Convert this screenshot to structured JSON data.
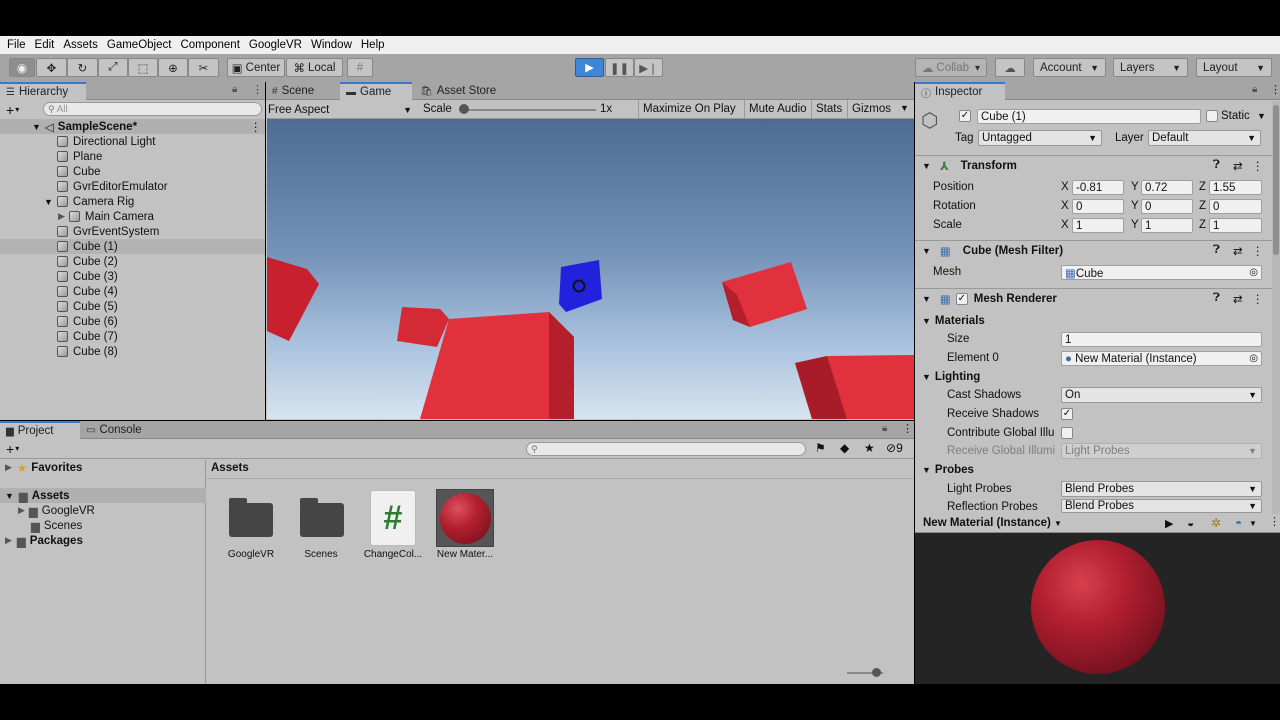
{
  "menu": [
    "File",
    "Edit",
    "Assets",
    "GameObject",
    "Component",
    "GoogleVR",
    "Window",
    "Help"
  ],
  "toolbar": {
    "pivot": "Center",
    "space": "Local",
    "collab": "Collab",
    "account": "Account",
    "layers": "Layers",
    "layout": "Layout"
  },
  "hierarchy": {
    "tab": "Hierarchy",
    "search_placeholder": "All",
    "scene": "SampleScene*",
    "items": [
      {
        "label": "Directional Light"
      },
      {
        "label": "Plane"
      },
      {
        "label": "Cube"
      },
      {
        "label": "GvrEditorEmulator"
      },
      {
        "label": "Camera Rig"
      },
      {
        "label": "Main Camera"
      },
      {
        "label": "GvrEventSystem"
      },
      {
        "label": "Cube (1)"
      },
      {
        "label": "Cube (2)"
      },
      {
        "label": "Cube (3)"
      },
      {
        "label": "Cube (4)"
      },
      {
        "label": "Cube (5)"
      },
      {
        "label": "Cube (6)"
      },
      {
        "label": "Cube (7)"
      },
      {
        "label": "Cube (8)"
      }
    ]
  },
  "game": {
    "tab_scene": "Scene",
    "tab_game": "Game",
    "tab_store": "Asset Store",
    "aspect": "Free Aspect",
    "scale_label": "Scale",
    "scale_value": "1x",
    "maximize": "Maximize On Play",
    "mute": "Mute Audio",
    "stats": "Stats",
    "gizmos": "Gizmos"
  },
  "project": {
    "tab_project": "Project",
    "tab_console": "Console",
    "favorites": "Favorites",
    "assets_root": "Assets",
    "googlevr": "GoogleVR",
    "scenes": "Scenes",
    "packages": "Packages",
    "breadcrumb": "Assets",
    "hidden_count": "9",
    "assets": [
      {
        "label": "GoogleVR"
      },
      {
        "label": "Scenes"
      },
      {
        "label": "ChangeCol..."
      },
      {
        "label": "New Mater..."
      }
    ],
    "script_glyph": "#"
  },
  "inspector": {
    "tab": "Inspector",
    "object_name": "Cube (1)",
    "static_label": "Static",
    "tag_label": "Tag",
    "tag_value": "Untagged",
    "layer_label": "Layer",
    "layer_value": "Default",
    "transform": {
      "title": "Transform",
      "position_label": "Position",
      "rotation_label": "Rotation",
      "scale_label": "Scale",
      "position": {
        "x": "-0.81",
        "y": "0.72",
        "z": "1.55"
      },
      "rotation": {
        "x": "0",
        "y": "0",
        "z": "0"
      },
      "scale": {
        "x": "1",
        "y": "1",
        "z": "1"
      }
    },
    "axis": {
      "x": "X",
      "y": "Y",
      "z": "Z"
    },
    "mesh_filter": {
      "title": "Cube (Mesh Filter)",
      "mesh_label": "Mesh",
      "mesh_value": "Cube"
    },
    "mesh_renderer": {
      "title": "Mesh Renderer",
      "materials": "Materials",
      "size_label": "Size",
      "size_value": "1",
      "element0_label": "Element 0",
      "element0_value": "New Material (Instance)",
      "lighting": "Lighting",
      "cast_shadows_label": "Cast Shadows",
      "cast_shadows_value": "On",
      "receive_shadows_label": "Receive Shadows",
      "contribute_gi_label": "Contribute Global Illu",
      "receive_gi_label": "Receive Global Illumi",
      "receive_gi_value": "Light Probes",
      "probes": "Probes",
      "light_probes_label": "Light Probes",
      "light_probes_value": "Blend Probes",
      "reflection_probes_label": "Reflection Probes",
      "reflection_probes_value": "Blend Probes"
    }
  },
  "preview": {
    "title": "New Material (Instance)"
  },
  "colors": {
    "cube_red": "#e0313d",
    "cube_blue": "#2222dd",
    "play_blue": "#3f86d8",
    "sphere_red": "#b21f30"
  }
}
